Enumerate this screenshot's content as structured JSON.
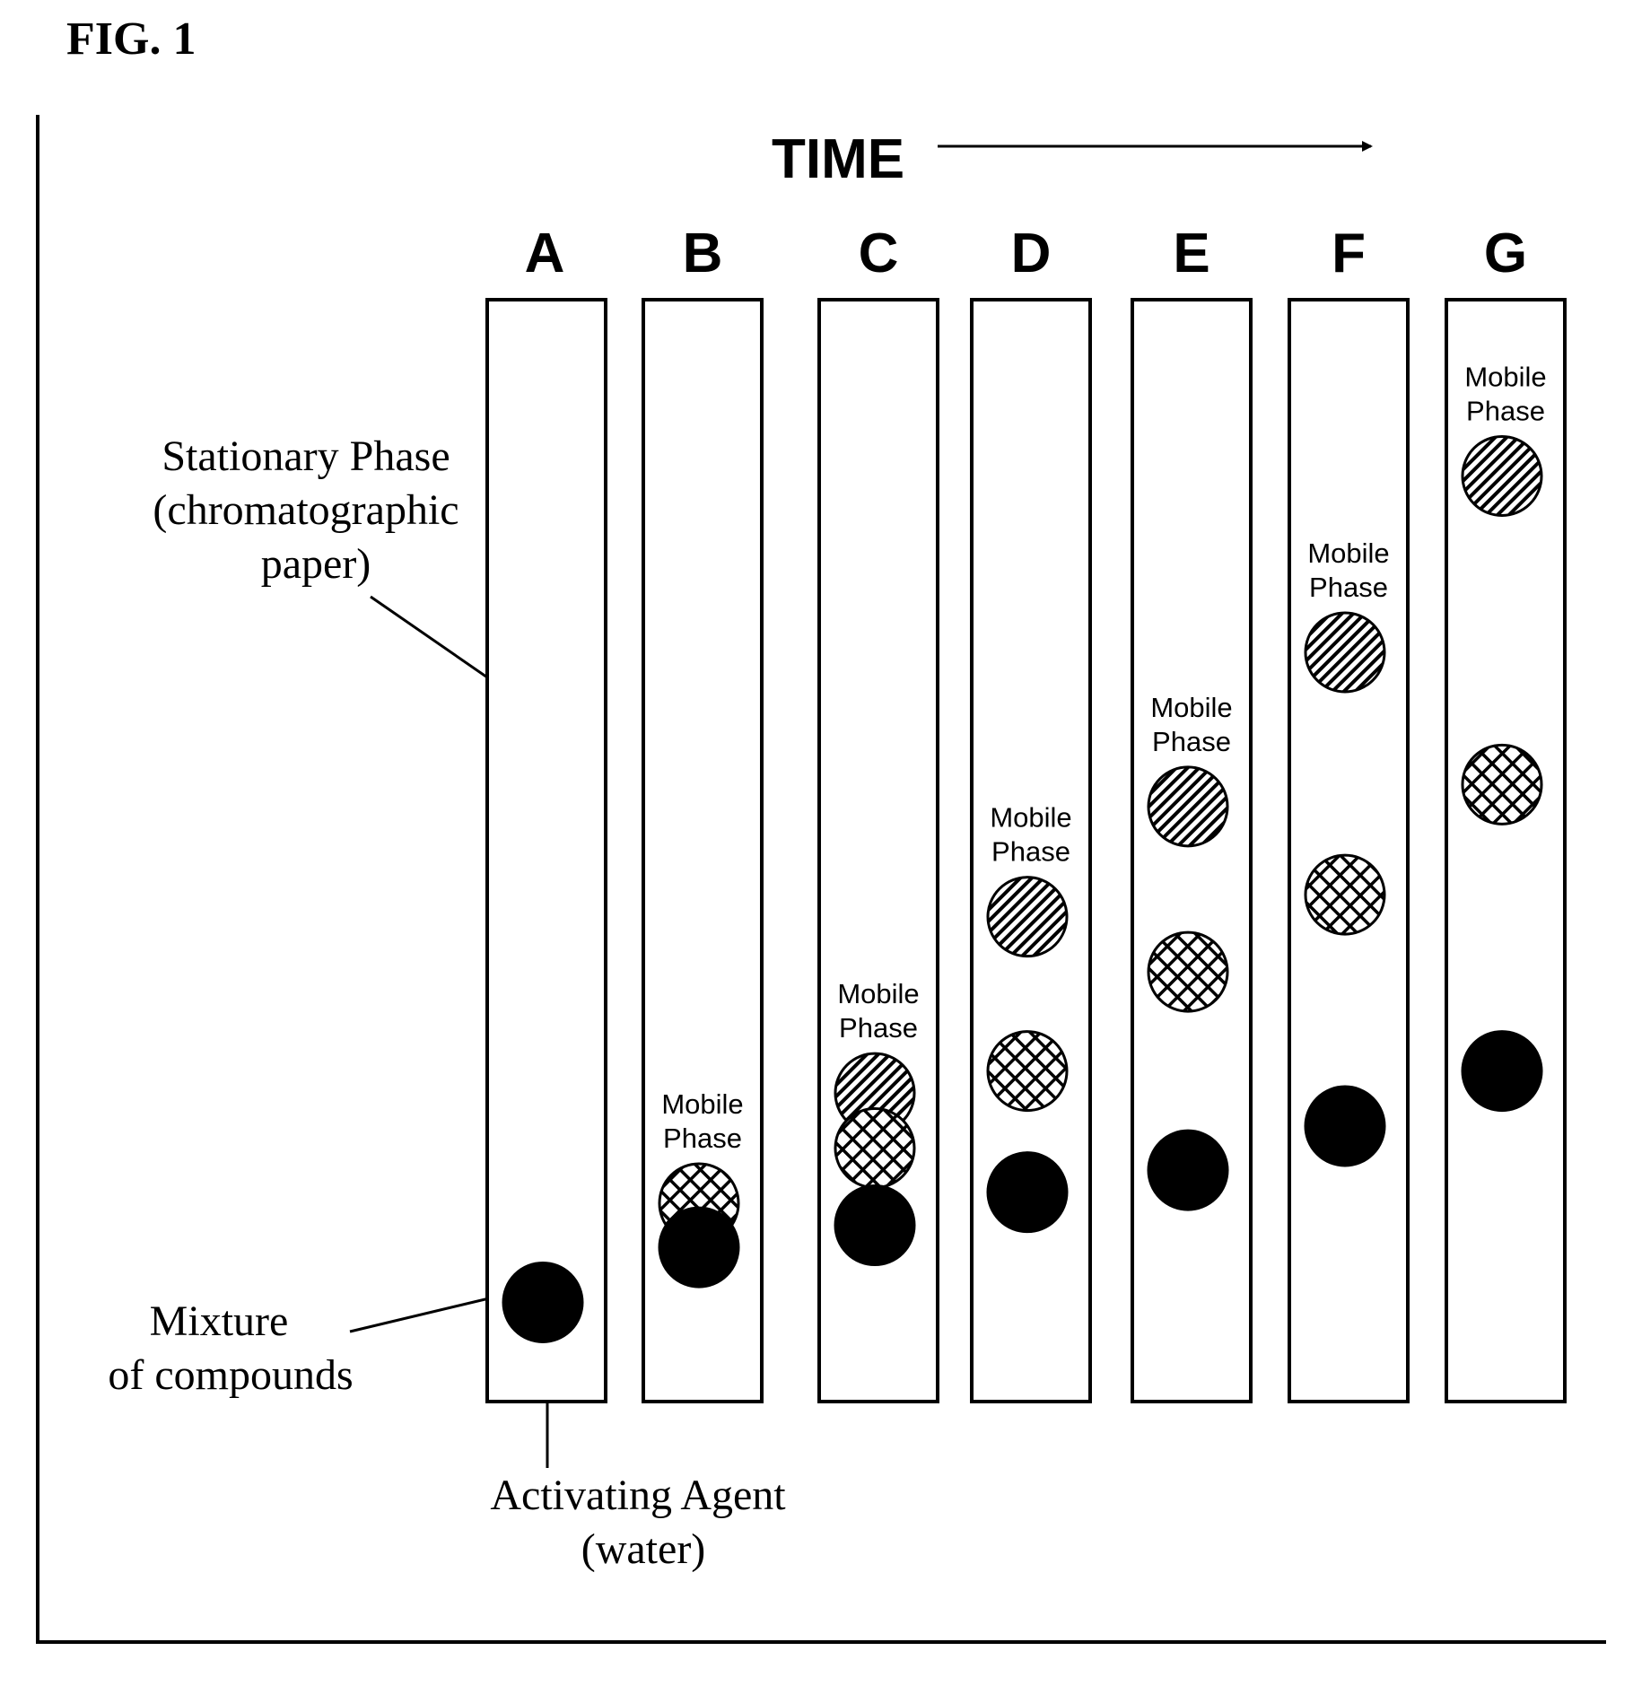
{
  "figure": {
    "title": "FIG. 1",
    "time_label": "TIME",
    "colors": {
      "ink": "#000000",
      "paper": "#ffffff"
    }
  },
  "annotations": {
    "stationary_phase": [
      "Stationary Phase",
      "(chromatographic",
      "paper)"
    ],
    "mixture": [
      "Mixture",
      "of compounds"
    ],
    "activating_agent": [
      "Activating Agent",
      "(water)"
    ]
  },
  "strips": [
    {
      "label": "A",
      "mobile_phase_label": null,
      "spots": [
        {
          "pattern": "solid",
          "position": 0.09
        }
      ]
    },
    {
      "label": "B",
      "mobile_phase_label": [
        "Mobile",
        "Phase"
      ],
      "spots": [
        {
          "pattern": "crosshatch",
          "position": 0.18
        },
        {
          "pattern": "solid",
          "position": 0.14
        }
      ]
    },
    {
      "label": "C",
      "mobile_phase_label": [
        "Mobile",
        "Phase"
      ],
      "spots": [
        {
          "pattern": "diagonal",
          "position": 0.28
        },
        {
          "pattern": "crosshatch",
          "position": 0.23
        },
        {
          "pattern": "solid",
          "position": 0.16
        }
      ]
    },
    {
      "label": "D",
      "mobile_phase_label": [
        "Mobile",
        "Phase"
      ],
      "spots": [
        {
          "pattern": "diagonal",
          "position": 0.44
        },
        {
          "pattern": "crosshatch",
          "position": 0.3
        },
        {
          "pattern": "solid",
          "position": 0.19
        }
      ]
    },
    {
      "label": "E",
      "mobile_phase_label": [
        "Mobile",
        "Phase"
      ],
      "spots": [
        {
          "pattern": "diagonal",
          "position": 0.54
        },
        {
          "pattern": "crosshatch",
          "position": 0.39
        },
        {
          "pattern": "solid",
          "position": 0.21
        }
      ]
    },
    {
      "label": "F",
      "mobile_phase_label": [
        "Mobile",
        "Phase"
      ],
      "spots": [
        {
          "pattern": "diagonal",
          "position": 0.68
        },
        {
          "pattern": "crosshatch",
          "position": 0.46
        },
        {
          "pattern": "solid",
          "position": 0.25
        }
      ]
    },
    {
      "label": "G",
      "mobile_phase_label": [
        "Mobile",
        "Phase"
      ],
      "spots": [
        {
          "pattern": "diagonal",
          "position": 0.84
        },
        {
          "pattern": "crosshatch",
          "position": 0.56
        },
        {
          "pattern": "solid",
          "position": 0.3
        }
      ]
    }
  ]
}
